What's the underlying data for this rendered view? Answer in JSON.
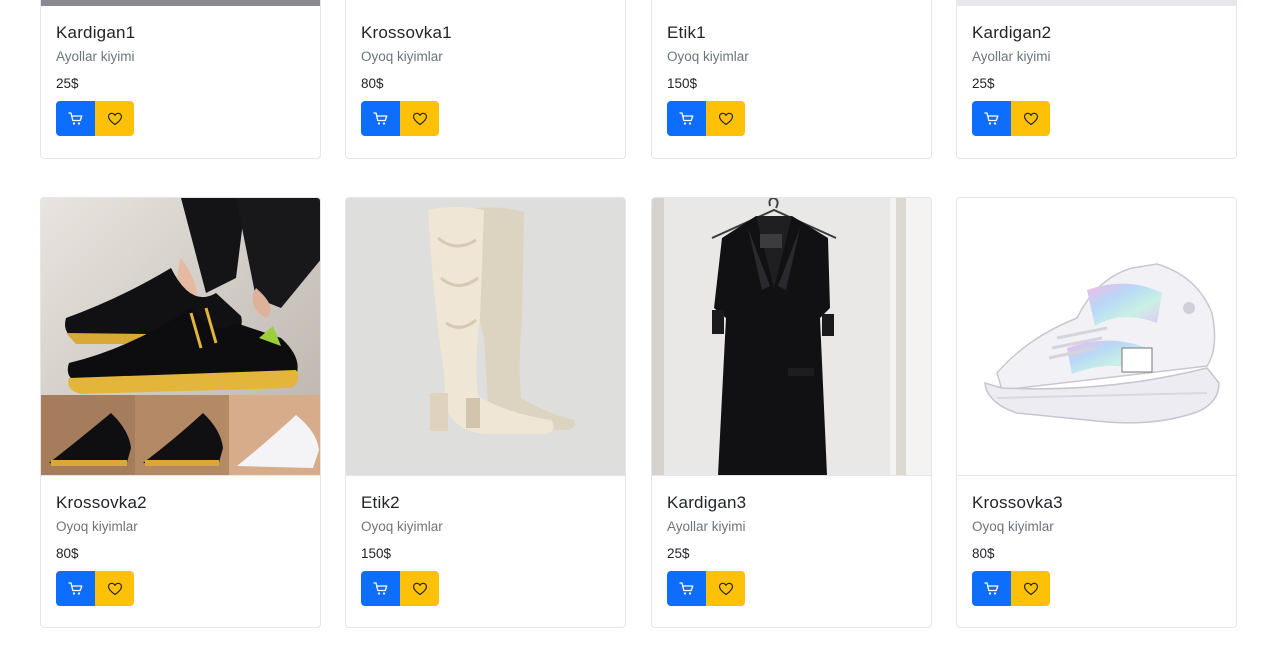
{
  "products_top": [
    {
      "title": "Kardigan1",
      "category": "Ayollar kiyimi",
      "price": "25$"
    },
    {
      "title": "Krossovka1",
      "category": "Oyoq kiyimlar",
      "price": "80$"
    },
    {
      "title": "Etik1",
      "category": "Oyoq kiyimlar",
      "price": "150$"
    },
    {
      "title": "Kardigan2",
      "category": "Ayollar kiyimi",
      "price": "25$"
    }
  ],
  "products_bottom": [
    {
      "title": "Krossovka2",
      "category": "Oyoq kiyimlar",
      "price": "80$"
    },
    {
      "title": "Etik2",
      "category": "Oyoq kiyimlar",
      "price": "150$"
    },
    {
      "title": "Kardigan3",
      "category": "Ayollar kiyimi",
      "price": "25$"
    },
    {
      "title": "Krossovka3",
      "category": "Oyoq kiyimlar",
      "price": "80$"
    }
  ],
  "icons": {
    "cart": "cart-icon",
    "favorite": "heart-icon"
  },
  "colors": {
    "cart_button": "#0d6efd",
    "favorite_button": "#ffc107"
  }
}
